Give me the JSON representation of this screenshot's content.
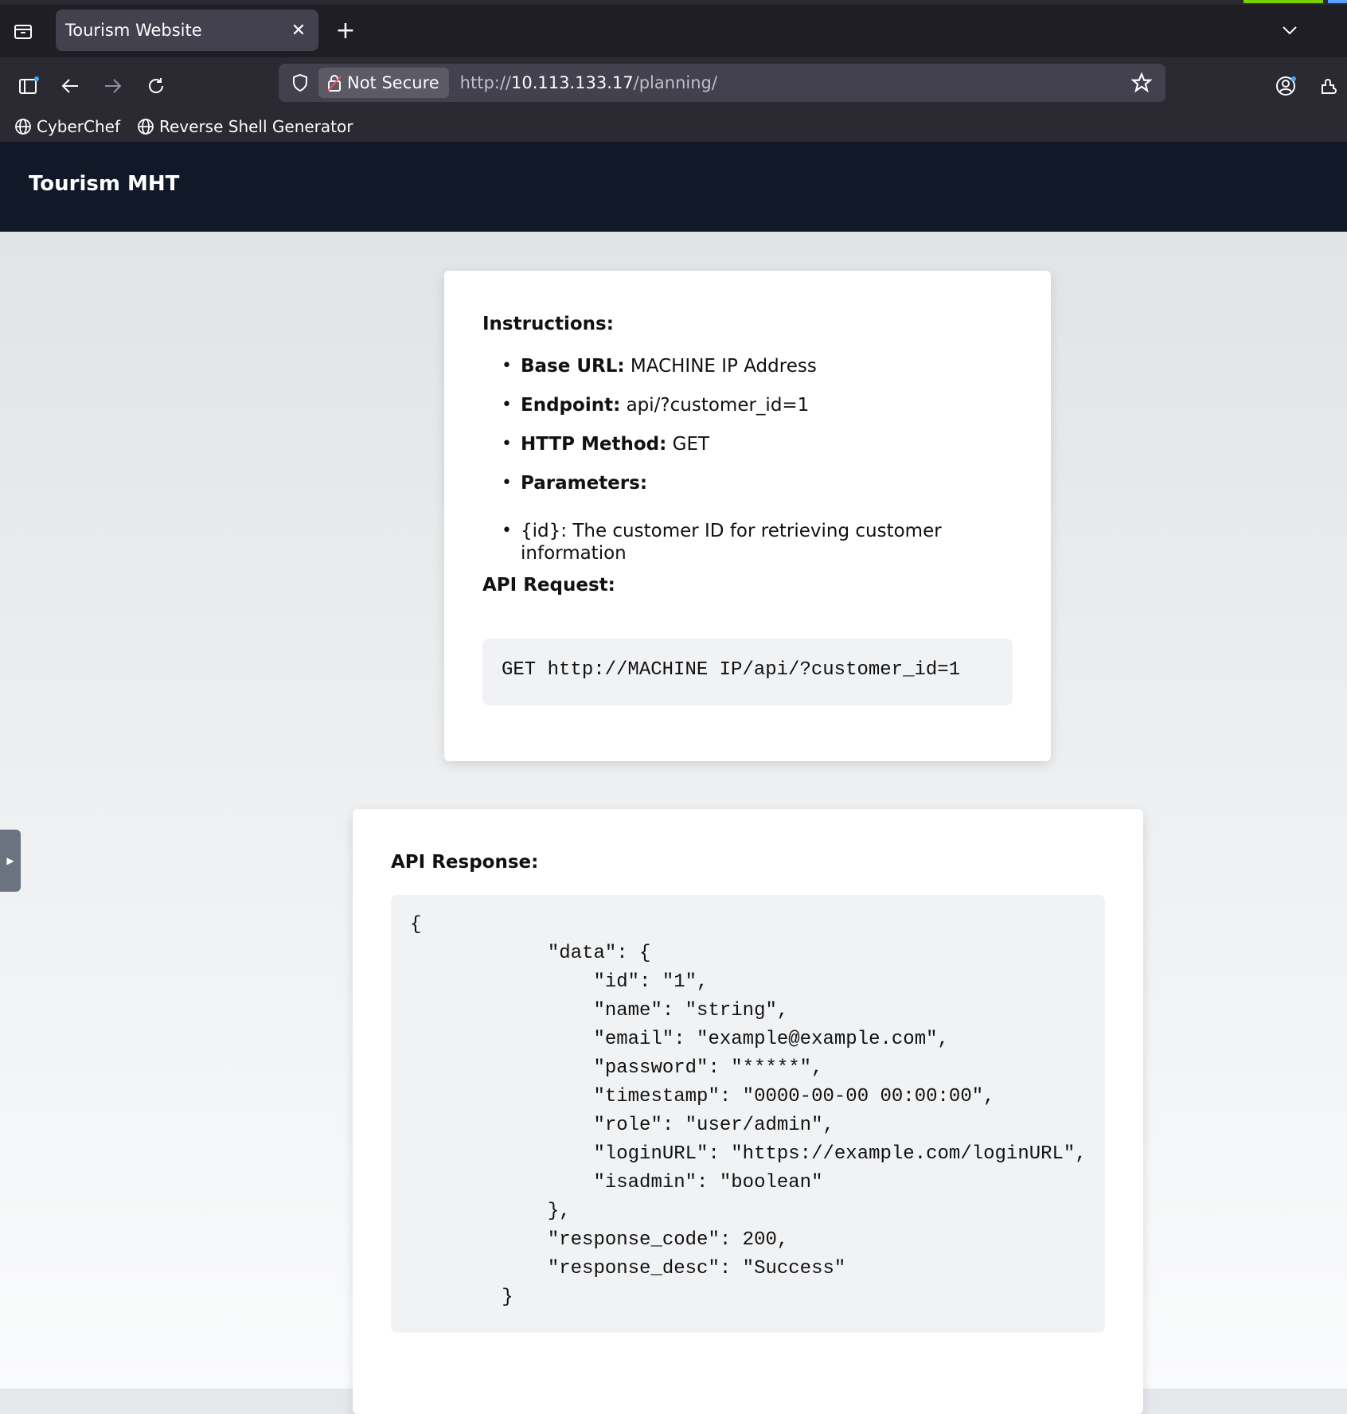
{
  "browser": {
    "tab_title": "Tourism Website",
    "url_prefix": "http://",
    "url_host": "10.113.133.17",
    "url_path": "/planning/",
    "security_label": "Not Secure",
    "bookmarks": [
      "CyberChef",
      "Reverse Shell Generator"
    ]
  },
  "site": {
    "title": "Tourism MHT"
  },
  "instructions": {
    "heading": "Instructions:",
    "items": [
      {
        "label": "Base URL:",
        "value": " MACHINE IP Address"
      },
      {
        "label": "Endpoint:",
        "value": " api/?customer_id=1"
      },
      {
        "label": "HTTP Method:",
        "value": " GET"
      },
      {
        "label": "Parameters:",
        "value": ""
      },
      {
        "label": "",
        "value": "{id}: The customer ID for retrieving customer information"
      }
    ],
    "request_heading": "API Request:",
    "request_code": "GET http://MACHINE IP/api/?customer_id=1"
  },
  "response": {
    "heading": "API Response:",
    "code": "{\n            \"data\": {\n                \"id\": \"1\",\n                \"name\": \"string\",\n                \"email\": \"example@example.com\",\n                \"password\": \"*****\",\n                \"timestamp\": \"0000-00-00 00:00:00\",\n                \"role\": \"user/admin\",\n                \"loginURL\": \"https://example.com/loginURL\",\n                \"isadmin\": \"boolean\"\n            },\n            \"response_code\": 200,\n            \"response_desc\": \"Success\"\n        }"
  }
}
